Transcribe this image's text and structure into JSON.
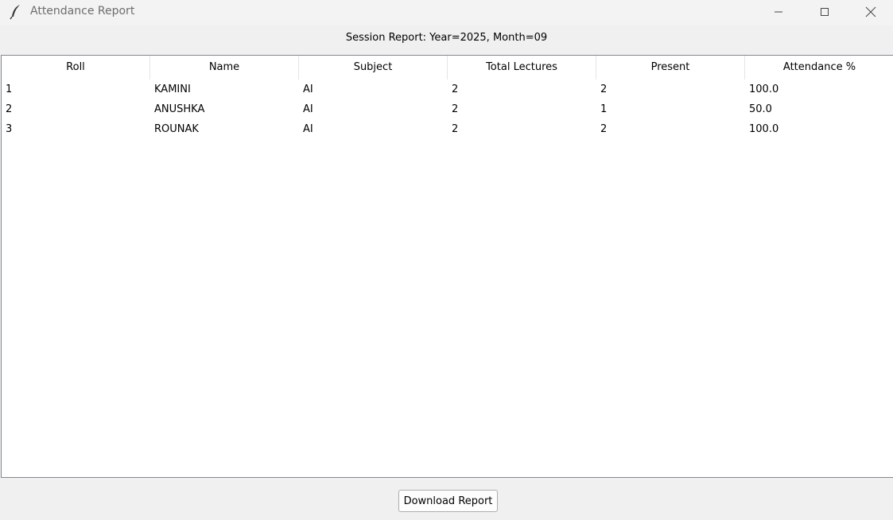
{
  "window": {
    "title": "Attendance Report",
    "icon": "feather-icon",
    "controls": [
      "minimize-icon",
      "maximize-icon",
      "close-icon"
    ]
  },
  "session": {
    "label": "Session Report: Year=2025, Month=09"
  },
  "table": {
    "columns": [
      "Roll",
      "Name",
      "Subject",
      "Total Lectures",
      "Present",
      "Attendance %"
    ],
    "rows": [
      [
        "1",
        "KAMINI",
        "AI",
        "2",
        "2",
        "100.0"
      ],
      [
        "2",
        "ANUSHKA",
        "AI",
        "2",
        "1",
        "50.0"
      ],
      [
        "3",
        "ROUNAK",
        "AI",
        "2",
        "2",
        "100.0"
      ]
    ]
  },
  "actions": {
    "download_label": "Download Report"
  }
}
